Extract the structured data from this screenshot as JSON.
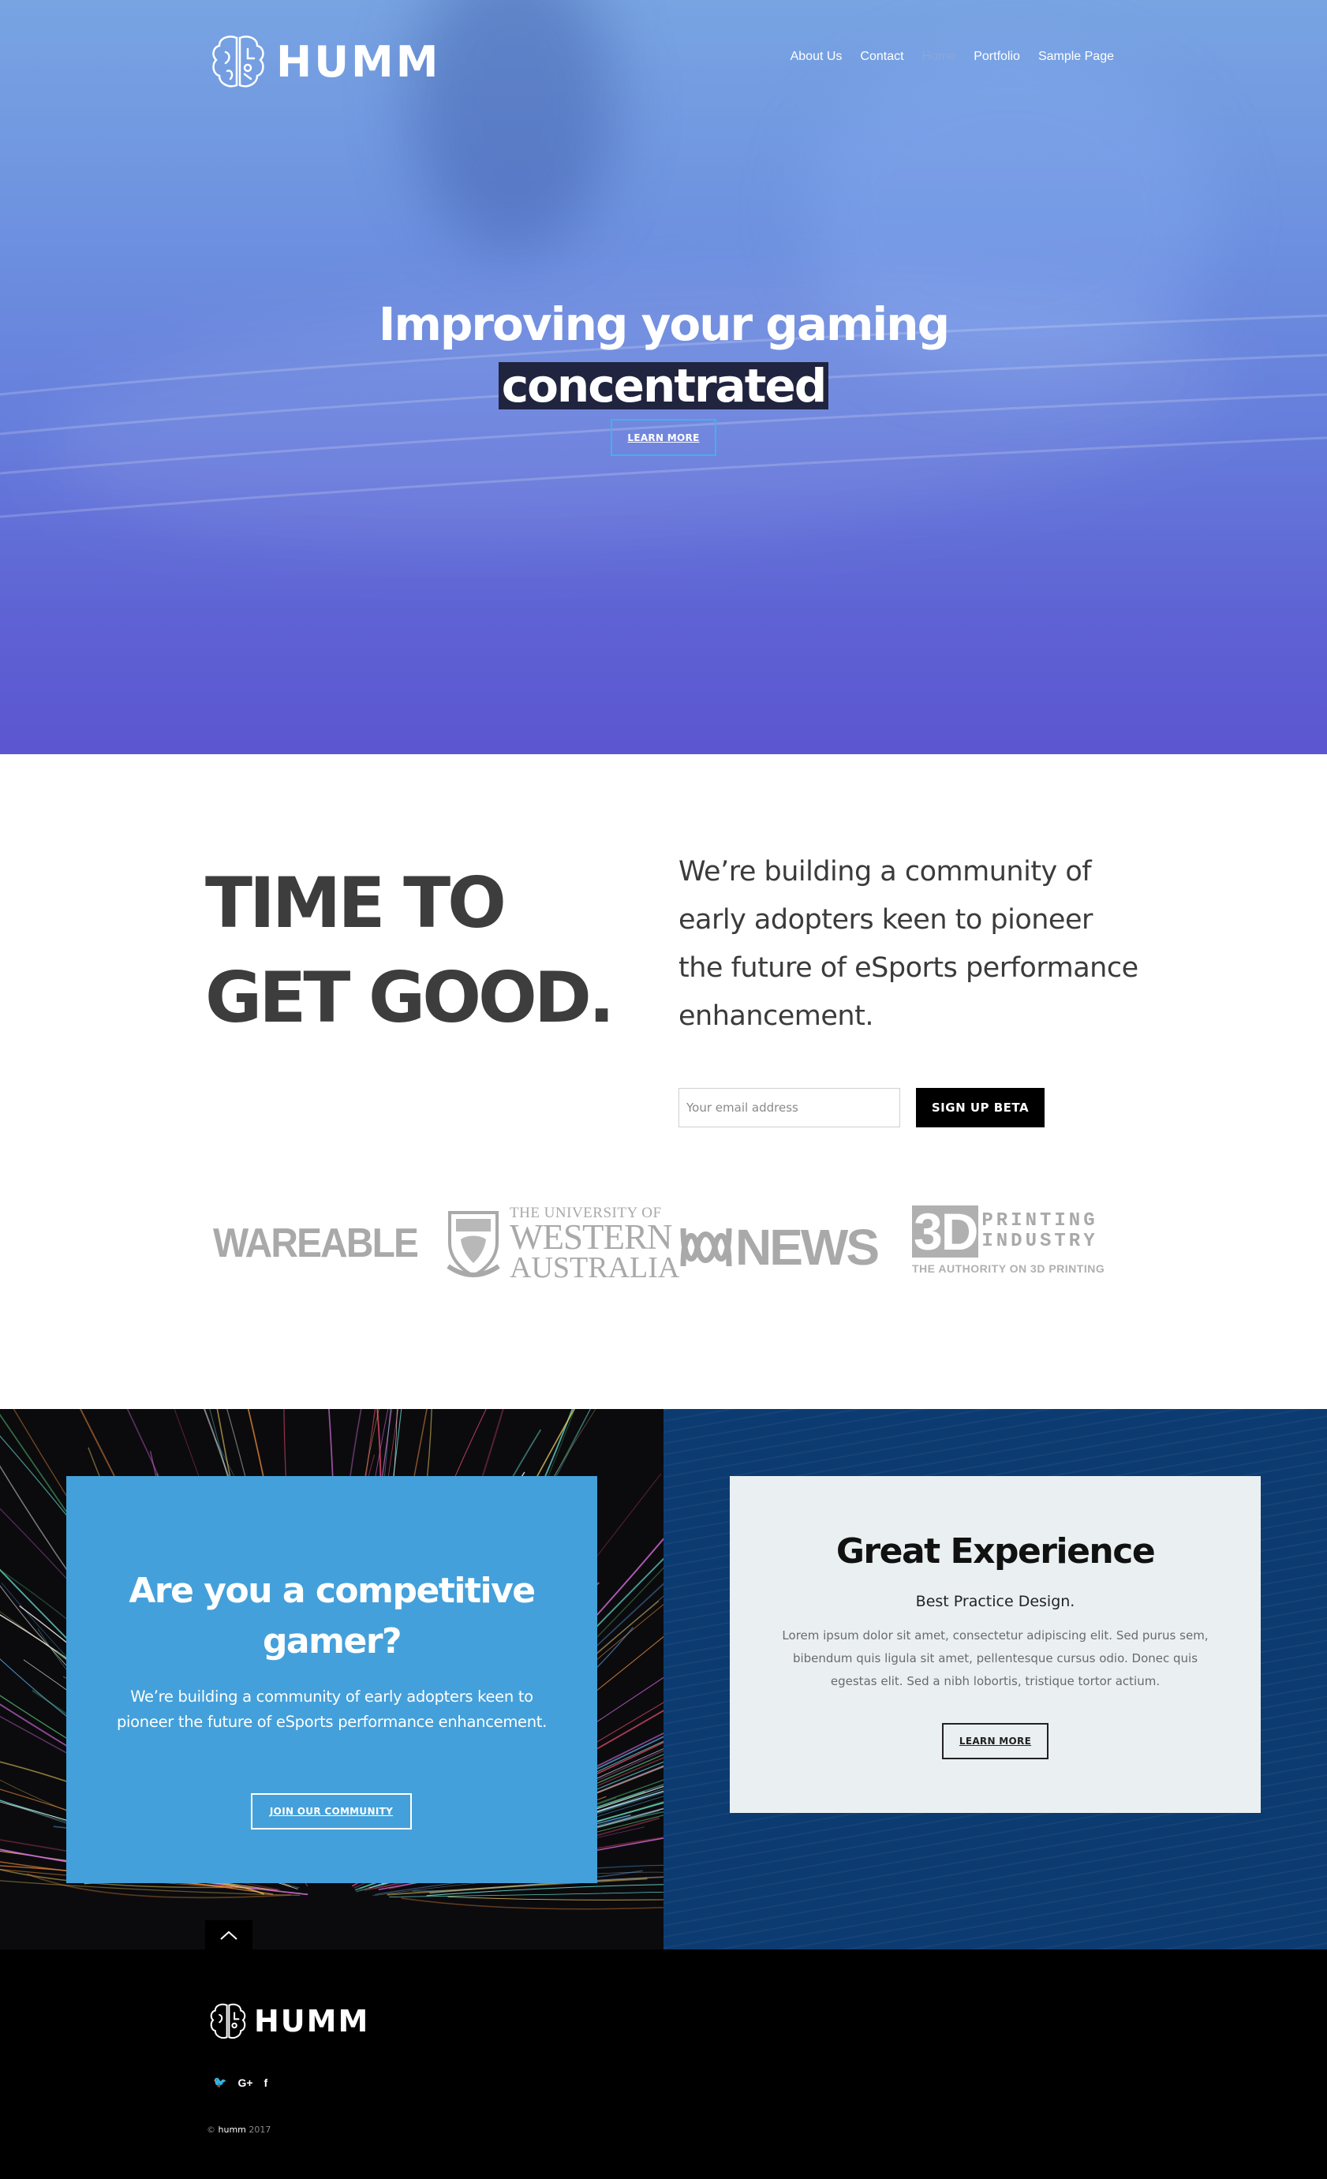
{
  "header": {
    "logo_text": "HUMM",
    "nav": [
      "About Us",
      "Contact",
      "Home",
      "Portfolio",
      "Sample Page"
    ]
  },
  "hero": {
    "title_line1": "Improving your gaming",
    "title_line2": "concentrated",
    "button_label": "LEARN MORE"
  },
  "intro": {
    "title_line1": "TIME TO",
    "title_line2": "GET GOOD.",
    "text": "We’re building a community of early adopters keen to pioneer the future of eSports performance enhancement.",
    "email_placeholder": "Your email address",
    "signup_label": "SIGN UP BETA"
  },
  "press": {
    "wareable": "WAREABLE",
    "uwa_line1": "THE UNIVERSITY OF",
    "uwa_line2": "WESTERN",
    "uwa_line3": "AUSTRALIA",
    "abc": "NEWS",
    "tdp_3d": "3D",
    "tdp_line1": "PRINTING",
    "tdp_line2": "INDUSTRY",
    "tdp_sub": "THE AUTHORITY ON 3D PRINTING"
  },
  "competitive": {
    "title": "Are you a competitive gamer?",
    "text": "We’re building a community of early adopters keen to pioneer the future of eSports performance enhancement.",
    "button_label": "JOIN OUR COMMUNITY"
  },
  "experience": {
    "title": "Great Experience",
    "subtitle": "Best Practice Design.",
    "text": "Lorem ipsum dolor sit amet, consectetur adipiscing elit. Sed purus sem, bibendum quis ligula sit amet, pellentesque cursus odio. Donec quis egestas elit. Sed a nibh lobortis, tristique tortor actium.",
    "button_label": "LEARN MORE"
  },
  "footer": {
    "logo_text": "HUMM",
    "social": [
      "twitter-icon",
      "google-plus-icon",
      "facebook-icon"
    ],
    "social_glyphs": [
      "🐦",
      "G+",
      "f"
    ],
    "copyright_prefix": "© ",
    "copyright_brand": "humm",
    "copyright_year": " 2017"
  },
  "colors": {
    "hero_top": "#78a4e2",
    "hero_bottom": "#5c56d0",
    "accent_blue": "#44a0da",
    "navy": "#0c3b71",
    "button_border": "#45b0e8"
  }
}
